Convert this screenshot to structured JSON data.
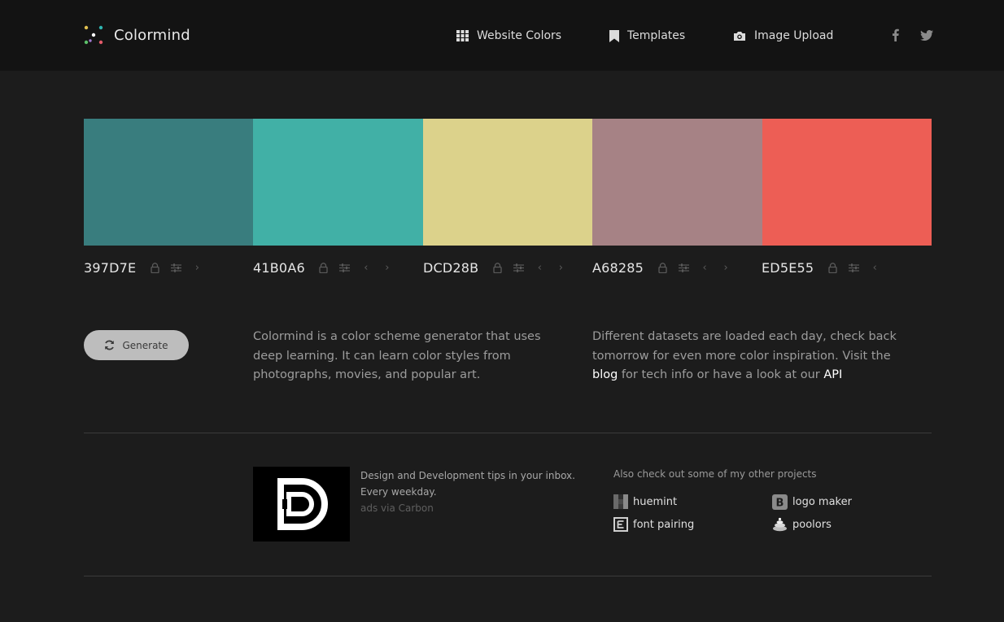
{
  "header": {
    "brand": "Colormind",
    "nav": [
      {
        "label": "Website Colors",
        "icon": "grid-icon"
      },
      {
        "label": "Templates",
        "icon": "bookmark-icon"
      },
      {
        "label": "Image Upload",
        "icon": "camera-icon"
      }
    ],
    "social": [
      "facebook-icon",
      "twitter-icon"
    ]
  },
  "palette": [
    {
      "hex": "397D7E",
      "color": "#397D7E"
    },
    {
      "hex": "41B0A6",
      "color": "#41B0A6"
    },
    {
      "hex": "DCD28B",
      "color": "#DCD28B"
    },
    {
      "hex": "A68285",
      "color": "#A68285"
    },
    {
      "hex": "ED5E55",
      "color": "#ED5E55"
    }
  ],
  "generate": {
    "label": "Generate"
  },
  "intro": {
    "text": "Colormind is a color scheme generator that uses deep learning. It can learn color styles from photographs, movies, and popular art."
  },
  "datasets": {
    "text_before": "Different datasets are loaded each day, check back tomorrow for even more color inspiration. Visit the",
    "blog_link": "blog",
    "text_middle": "for tech info or have a look at our",
    "api_link": "API"
  },
  "ad": {
    "line1": "Design and Development tips in your inbox.",
    "line2": "Every weekday.",
    "via": "ads via Carbon"
  },
  "projects": {
    "title": "Also check out some of my other projects",
    "items": [
      {
        "label": "huemint",
        "icon": "huemint-icon"
      },
      {
        "label": "logo maker",
        "icon": "logo-maker-icon"
      },
      {
        "label": "font pairing",
        "icon": "font-pairing-icon"
      },
      {
        "label": "poolors",
        "icon": "poolors-icon"
      }
    ]
  }
}
